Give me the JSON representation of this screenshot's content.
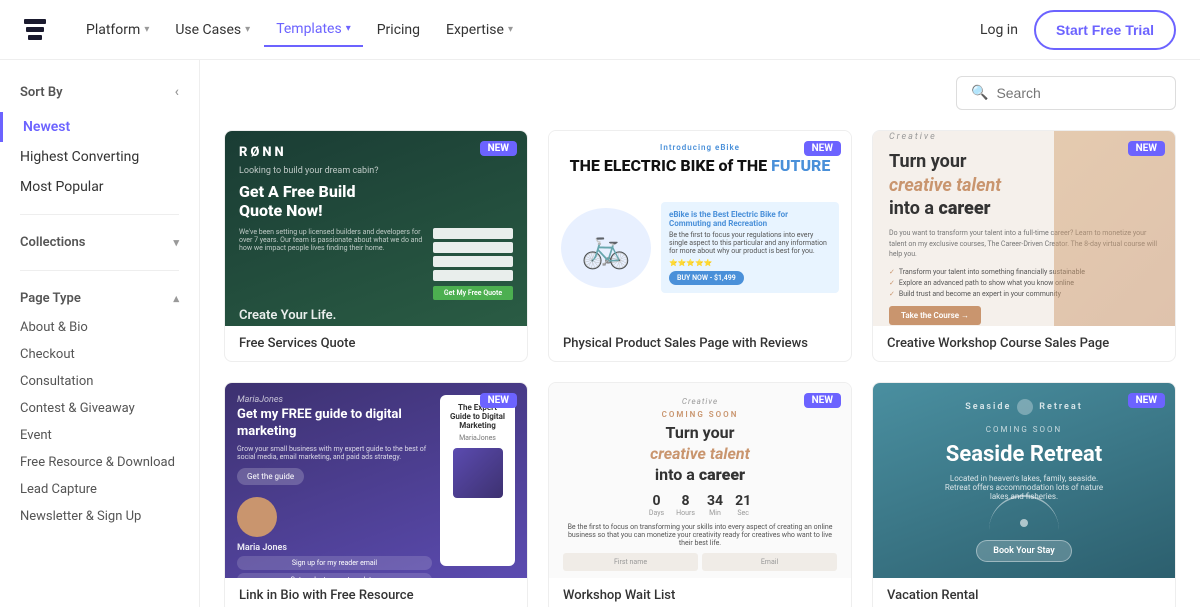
{
  "nav": {
    "logo_text": "≡",
    "links": [
      {
        "label": "Platform",
        "has_dropdown": true,
        "active": false
      },
      {
        "label": "Use Cases",
        "has_dropdown": true,
        "active": false
      },
      {
        "label": "Templates",
        "has_dropdown": true,
        "active": true
      },
      {
        "label": "Pricing",
        "has_dropdown": false,
        "active": false
      },
      {
        "label": "Expertise",
        "has_dropdown": true,
        "active": false
      }
    ],
    "login_label": "Log in",
    "trial_label": "Start Free Trial"
  },
  "sidebar": {
    "sort_by_label": "Sort By",
    "sort_items": [
      {
        "label": "Newest",
        "active": true
      },
      {
        "label": "Highest Converting",
        "active": false
      },
      {
        "label": "Most Popular",
        "active": false
      }
    ],
    "collections_label": "Collections",
    "page_type_label": "Page Type",
    "page_types": [
      {
        "label": "About & Bio"
      },
      {
        "label": "Checkout"
      },
      {
        "label": "Consultation"
      },
      {
        "label": "Contest & Giveaway"
      },
      {
        "label": "Event"
      },
      {
        "label": "Free Resource & Download"
      },
      {
        "label": "Lead Capture"
      },
      {
        "label": "Newsletter & Sign Up"
      }
    ]
  },
  "search": {
    "placeholder": "Search"
  },
  "cards": [
    {
      "label": "Free Services Quote",
      "badge": "NEW",
      "thumb_type": "green"
    },
    {
      "label": "Physical Product Sales Page with Reviews",
      "badge": "NEW",
      "thumb_type": "white-bike"
    },
    {
      "label": "Creative Workshop Course Sales Page",
      "badge": "NEW",
      "thumb_type": "cream-creative"
    },
    {
      "label": "Link in Bio with Free Resource",
      "badge": "NEW",
      "thumb_type": "purple-marketing"
    },
    {
      "label": "Workshop Wait List",
      "badge": "NEW",
      "thumb_type": "light-career"
    },
    {
      "label": "Vacation Rental",
      "badge": "NEW",
      "thumb_type": "teal-seaside"
    }
  ]
}
